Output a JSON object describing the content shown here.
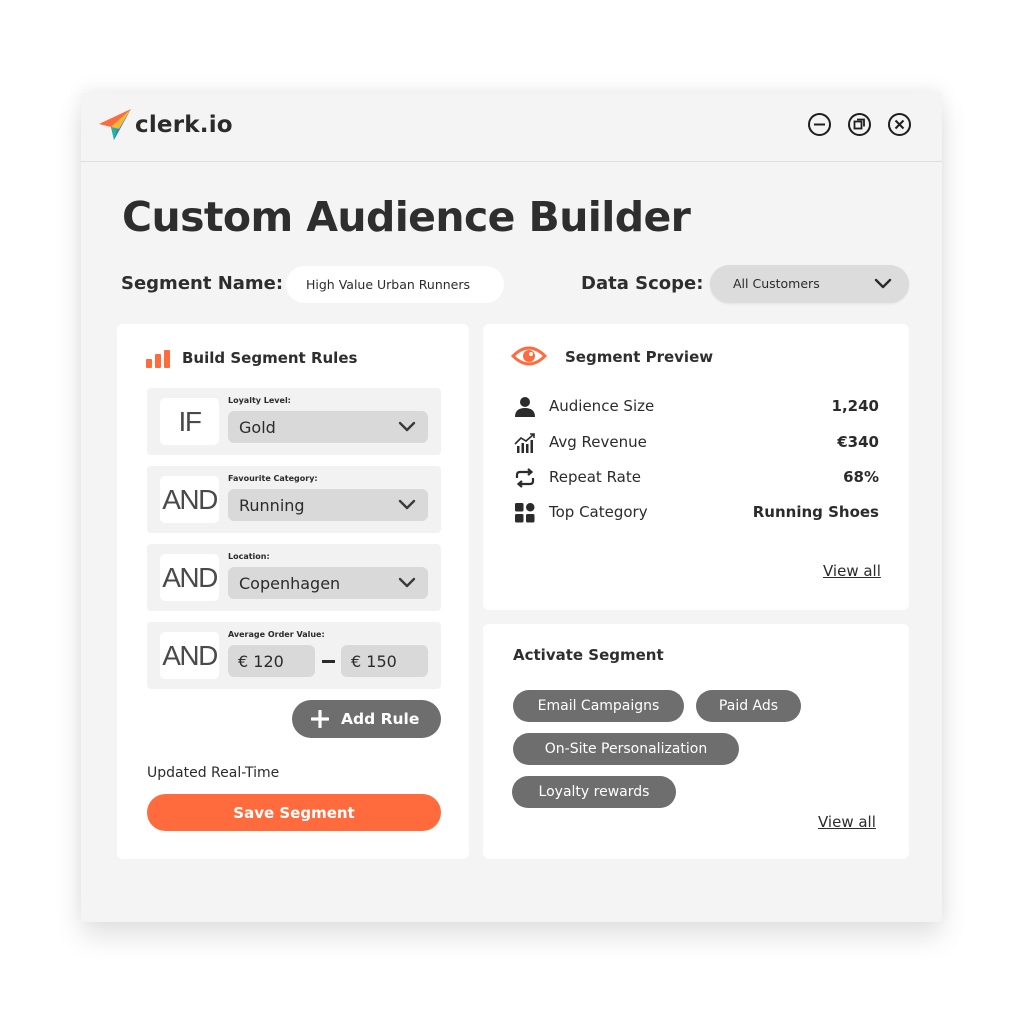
{
  "app": {
    "logo_text": "clerk.io",
    "window_controls": [
      "minimize-icon",
      "restore-icon",
      "close-icon"
    ]
  },
  "page": {
    "title": "Custom Audience Builder"
  },
  "segment": {
    "name_label": "Segment Name:",
    "name_value": "High Value Urban Runners",
    "scope_label": "Data Scope:",
    "scope_value": "All Customers"
  },
  "rules": {
    "title": "Build Segment Rules",
    "icon": "bar-chart-icon",
    "items": [
      {
        "operator": "IF",
        "field": "Loyalty Level:",
        "value": "Gold"
      },
      {
        "operator": "AND",
        "field": "Favourite Category:",
        "value": "Running"
      },
      {
        "operator": "AND",
        "field": "Location:",
        "value": "Copenhagen"
      },
      {
        "operator": "AND",
        "field": "Average Order Value:",
        "min": "€ 120",
        "max": "€ 150"
      }
    ],
    "add_rule_label": "Add Rule",
    "updated_text": "Updated Real-Time",
    "save_label": "Save Segment"
  },
  "preview": {
    "title": "Segment Preview",
    "icon": "eye-icon",
    "stats": [
      {
        "icon": "user-icon",
        "label": "Audience Size",
        "value": "1,240"
      },
      {
        "icon": "revenue-chart-icon",
        "label": "Avg Revenue",
        "value": "€340"
      },
      {
        "icon": "repeat-icon",
        "label": "Repeat Rate",
        "value": "68%"
      },
      {
        "icon": "grid-icon",
        "label": "Top Category",
        "value": "Running Shoes"
      }
    ],
    "view_all": "View all"
  },
  "activate": {
    "title": "Activate Segment",
    "channels": [
      "Email Campaigns",
      "Paid Ads",
      "On-Site Personalization",
      "Loyalty rewards"
    ],
    "view_all": "View all"
  },
  "colors": {
    "accent": "#ff6b3d",
    "chip": "#6e6e6e",
    "window_bg": "#f4f4f4",
    "card_bg": "#ffffff"
  }
}
